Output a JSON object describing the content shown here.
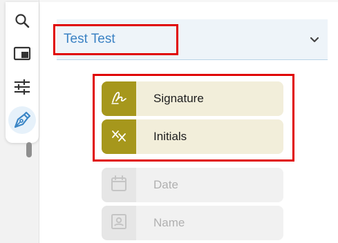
{
  "toolbar": {
    "items": [
      {
        "icon": "search-icon",
        "active": false
      },
      {
        "icon": "panel-icon",
        "active": false
      },
      {
        "icon": "sliders-icon",
        "active": false
      },
      {
        "icon": "pen-nib-icon",
        "active": true
      }
    ]
  },
  "recipient": {
    "name": "Test Test",
    "dropdown_icon": "chevron-down-icon"
  },
  "fields": {
    "signature": {
      "label": "Signature",
      "icon": "signature-icon",
      "enabled": true
    },
    "initials": {
      "label": "Initials",
      "icon": "initials-icon",
      "enabled": true
    },
    "date": {
      "label": "Date",
      "icon": "calendar-icon",
      "enabled": false
    },
    "name": {
      "label": "Name",
      "icon": "id-card-icon",
      "enabled": false
    }
  },
  "colors": {
    "field_accent": "#a6971c",
    "field_background": "#f2eeda",
    "recipient_text": "#3b82c4",
    "highlight_box": "#e00000"
  }
}
